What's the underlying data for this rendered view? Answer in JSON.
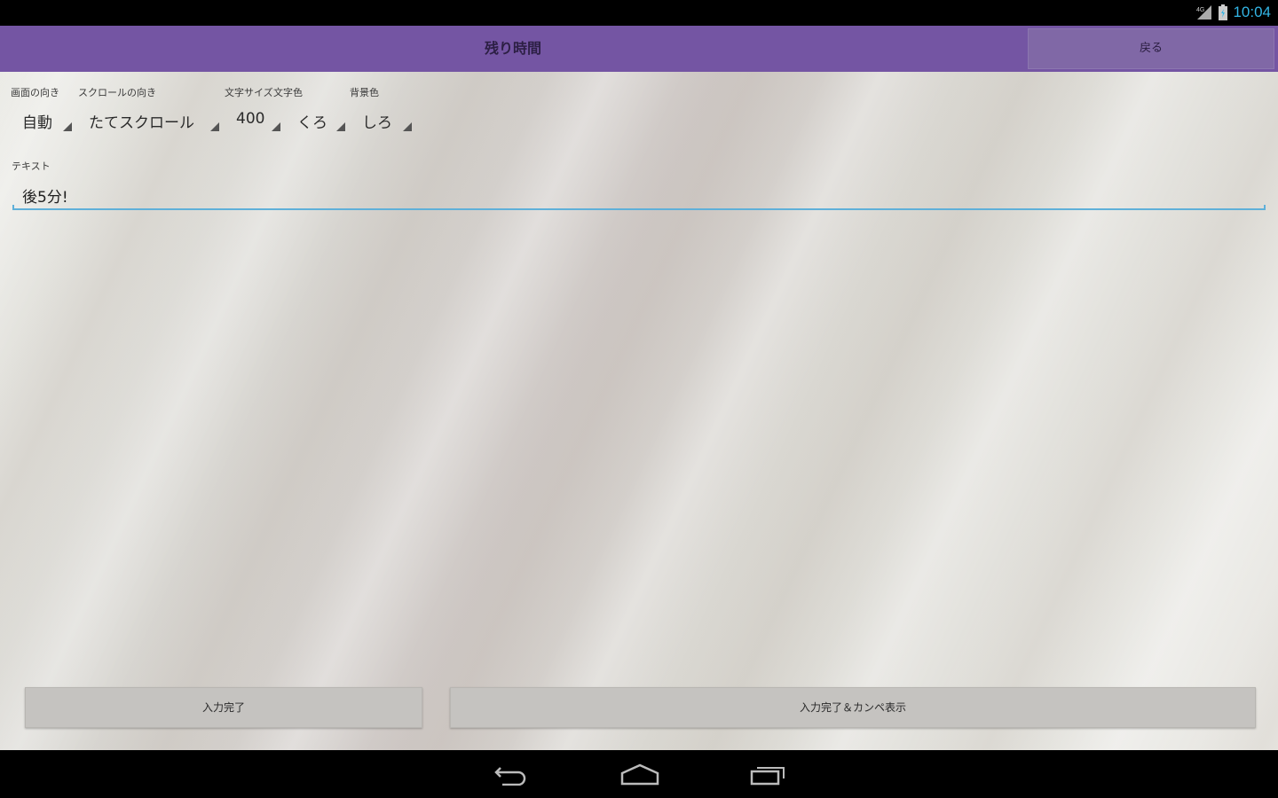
{
  "status": {
    "time": "10:04"
  },
  "action_bar": {
    "title": "残り時間",
    "back_label": "戻る"
  },
  "settings": {
    "orientation": {
      "label": "画面の向き",
      "value": "自動"
    },
    "scroll": {
      "label": "スクロールの向き",
      "value": "たてスクロール"
    },
    "font_size": {
      "label": "文字サイズ",
      "value": "400"
    },
    "text_color": {
      "label": "文字色",
      "value": "くろ"
    },
    "background_color": {
      "label": "背景色",
      "value": "しろ"
    }
  },
  "text": {
    "label": "テキスト",
    "value": "後5分!"
  },
  "buttons": {
    "done": "入力完了",
    "done_show": "入力完了＆カンペ表示"
  },
  "colors": {
    "accent": "#7455a3",
    "field_underline": "#5fb0d9",
    "status_time": "#33b5e5"
  },
  "nav": {
    "icons": [
      "back-icon",
      "home-icon",
      "recent-apps-icon"
    ]
  }
}
